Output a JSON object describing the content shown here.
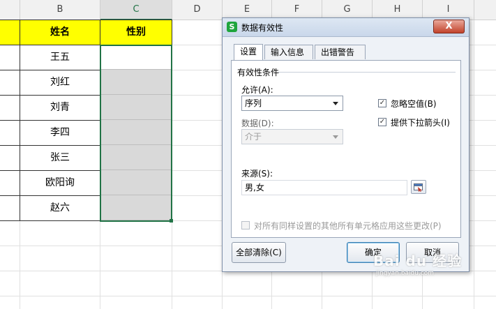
{
  "sheet": {
    "columns": [
      "B",
      "C",
      "D",
      "E",
      "F",
      "G",
      "H",
      "I"
    ],
    "header_name": "姓名",
    "header_gender": "性别",
    "names": [
      "王五",
      "刘红",
      "刘青",
      "李四",
      "张三",
      "欧阳询",
      "赵六"
    ]
  },
  "dialog": {
    "title": "数据有效性",
    "close_label": "X",
    "tabs": [
      "设置",
      "输入信息",
      "出错警告"
    ],
    "group_title": "有效性条件",
    "allow_label": "允许(A):",
    "allow_value": "序列",
    "data_label": "数据(D):",
    "data_value": "介于",
    "ignore_blank_label": "忽略空值(B)",
    "dropdown_label": "提供下拉箭头(I)",
    "source_label": "来源(S):",
    "source_value": "男,女",
    "apply_all_label": "对所有同样设置的其他所有单元格应用这些更改(P)",
    "clear_all_label": "全部清除(C)",
    "ok_label": "确定",
    "cancel_label": "取消"
  },
  "colors": {
    "header_fill": "#ffff00",
    "selection": "#217346",
    "gender_fill": "#d9d9d9"
  },
  "watermark": {
    "brand": "Bai du 经验",
    "url": "jingyan.baidu.com"
  }
}
